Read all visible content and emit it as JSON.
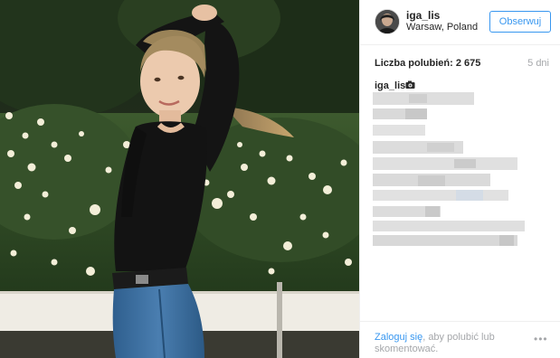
{
  "post": {
    "author": {
      "username": "iga_lis",
      "location": "Warsaw, Poland",
      "follow_label": "Obserwuj"
    },
    "likes_text": "Liczba polubień: 2 675",
    "age_text": "5 dni",
    "caption": {
      "username": "iga_lis",
      "emoji_icon": "camera-emoji-icon",
      "body": "[pixelated / obscured text]"
    },
    "footer": {
      "login_link": "Zaloguj się",
      "login_rest": ", aby polubić lub skomentować.",
      "more_icon": "more-options-icon"
    }
  },
  "colors": {
    "accent": "#3897f0",
    "text": "#262626",
    "muted": "#a5a7aa",
    "border": "#efefef"
  }
}
